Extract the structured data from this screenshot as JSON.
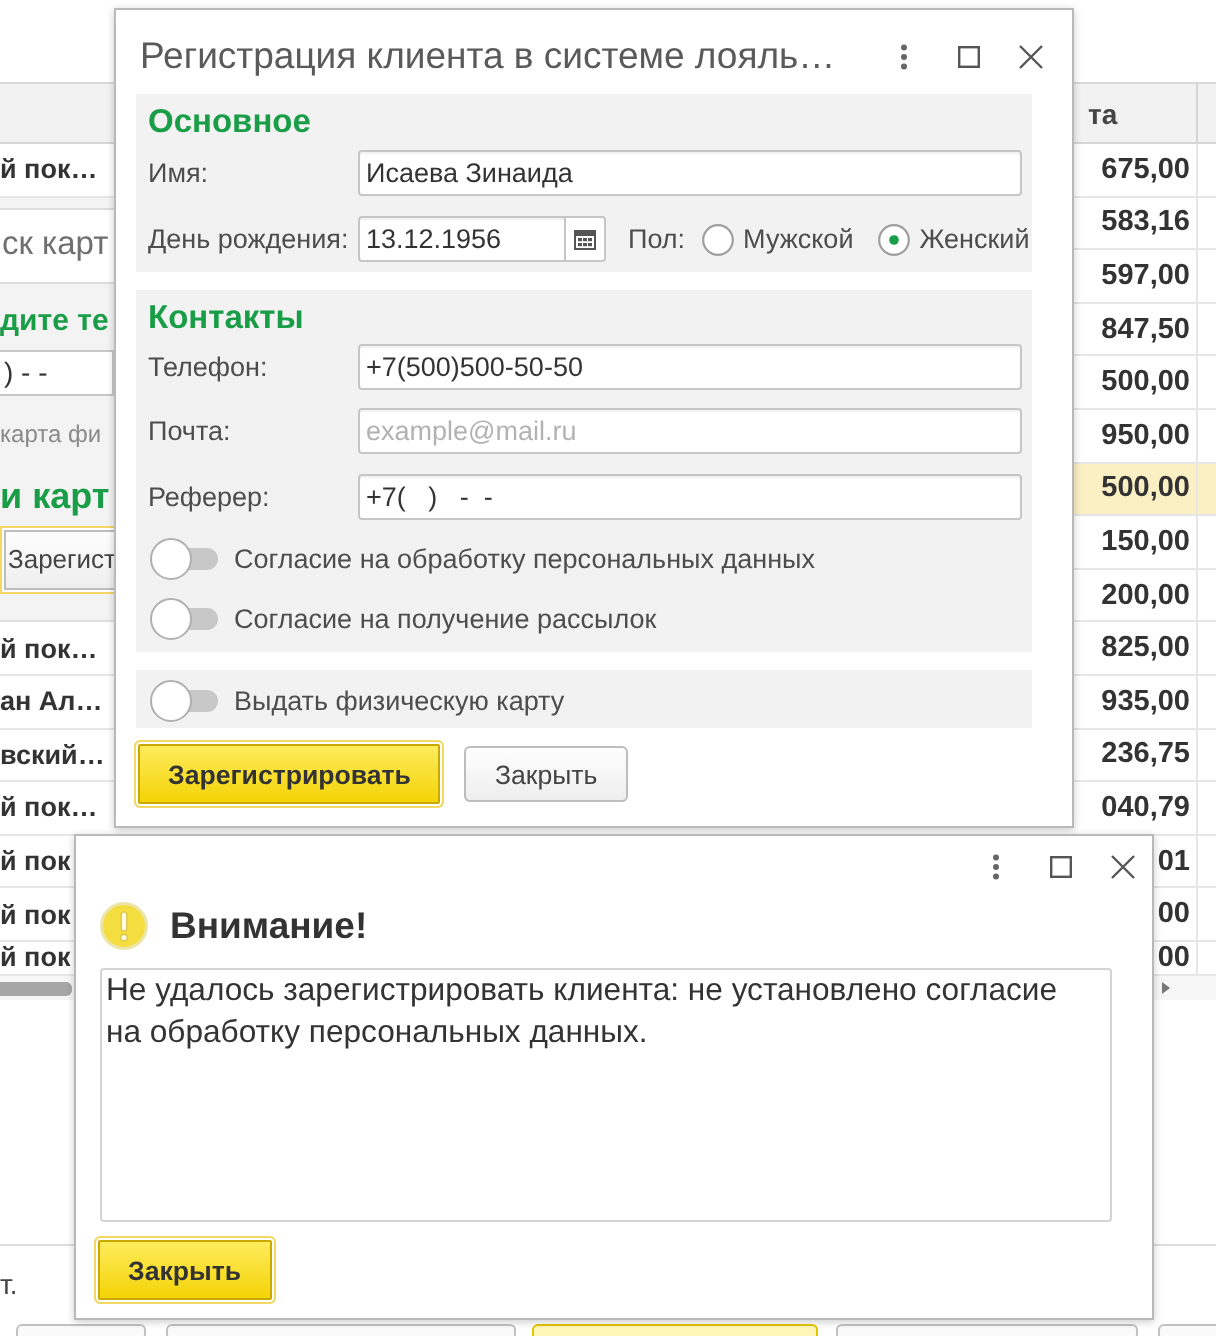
{
  "background_window": {
    "left_column": {
      "top_rows": [
        {
          "text": "й пок…"
        }
      ],
      "search_panel": {
        "search_field": {
          "placeholder": "ск карт"
        },
        "phone_heading": "дите те",
        "phone_field": {
          "value": ") - -"
        },
        "hint": "карта фи",
        "card_heading": "и карт",
        "button": {
          "label": "Зарегист",
          "kind": "secondary",
          "focused": true
        }
      },
      "bottom_rows": [
        {
          "text": "й пок…"
        },
        {
          "text": "ан Ал…"
        },
        {
          "text": "вский…"
        },
        {
          "text": "й пок…"
        },
        {
          "text": "й пок"
        },
        {
          "text": "й пок"
        },
        {
          "text": "й пок"
        }
      ]
    },
    "amount_column": {
      "header": "та",
      "rows": [
        {
          "value": "675,00",
          "selected": false
        },
        {
          "value": "583,16",
          "selected": false
        },
        {
          "value": "597,00",
          "selected": false
        },
        {
          "value": "847,50",
          "selected": false
        },
        {
          "value": "500,00",
          "selected": false
        },
        {
          "value": "950,00",
          "selected": false
        },
        {
          "value": "500,00",
          "selected": true
        },
        {
          "value": "150,00",
          "selected": false
        },
        {
          "value": "200,00",
          "selected": false
        },
        {
          "value": "825,00",
          "selected": false
        },
        {
          "value": "935,00",
          "selected": false
        },
        {
          "value": "236,75",
          "selected": false
        },
        {
          "value": "040,79",
          "selected": false
        },
        {
          "value": "01",
          "selected": false
        },
        {
          "value": "00",
          "selected": false
        },
        {
          "value": "00",
          "selected": false
        }
      ]
    },
    "footer_text": "т.",
    "toolbar_buttons": [
      {
        "kind": "secondary"
      },
      {
        "kind": "secondary"
      },
      {
        "kind": "primary"
      },
      {
        "kind": "secondary"
      },
      {
        "kind": "secondary"
      }
    ]
  },
  "registration_dialog": {
    "title": "Регистрация клиента в системе лояль…",
    "main_section": {
      "heading": "Основное",
      "name": {
        "label": "Имя:",
        "value": "Исаева Зинаида"
      },
      "birthday": {
        "label": "День рождения:",
        "value": "13.12.1956"
      },
      "gender": {
        "label": "Пол:",
        "options": [
          {
            "label": "Мужской",
            "selected": false
          },
          {
            "label": "Женский",
            "selected": true
          }
        ]
      }
    },
    "contacts_section": {
      "heading": "Контакты",
      "fields": [
        {
          "label": "Телефон:",
          "value": "+7(500)500-50-50"
        },
        {
          "label": "Почта:",
          "placeholder": "example@mail.ru"
        },
        {
          "label": "Реферер:",
          "value": "+7(   )   -  -"
        }
      ],
      "switches": [
        {
          "label": "Согласие на обработку персональных данных",
          "on": false
        },
        {
          "label": "Согласие на получение рассылок",
          "on": false
        }
      ]
    },
    "card_section": {
      "switches": [
        {
          "label": "Выдать физическую карту",
          "on": false
        }
      ]
    },
    "buttons": [
      {
        "label": "Зарегистрировать",
        "kind": "primary",
        "focused": true
      },
      {
        "label": "Закрыть",
        "kind": "secondary",
        "focused": false
      }
    ]
  },
  "alert_dialog": {
    "title": "Внимание!",
    "message": "Не удалось зарегистрировать клиента: не установлено согласие на обработку персональных данных.",
    "buttons": [
      {
        "label": "Закрыть",
        "kind": "primary",
        "focused": true
      }
    ]
  }
}
